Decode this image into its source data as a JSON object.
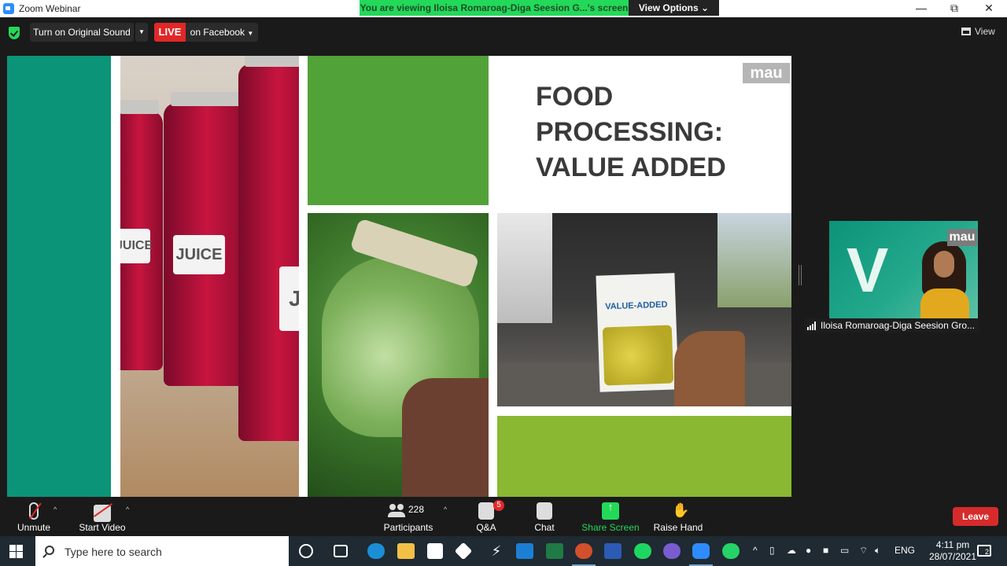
{
  "window": {
    "app_title": "Zoom Webinar",
    "viewing_banner": "You are viewing Iloisa Romaroag-Diga Seesion G...'s screen",
    "view_options": "View Options",
    "controls": {
      "minimize": "—",
      "restore": "⧉",
      "close": "✕"
    }
  },
  "topbar": {
    "original_sound": "Turn on Original Sound",
    "live": "LIVE",
    "live_on": "on Facebook",
    "view": "View"
  },
  "slide": {
    "title_lines": [
      "FOOD",
      "PROCESSING:",
      "VALUE ADDED"
    ],
    "logo": "mau",
    "jar_labels": [
      "JUICE",
      "JUICE",
      "JU"
    ],
    "booklet_title": "VALUE-ADDED"
  },
  "video": {
    "logo": "mau",
    "name": "Iloisa Romaroag-Diga Seesion Gro..."
  },
  "toolbar": {
    "unmute": "Unmute",
    "start_video": "Start Video",
    "participants_count": "228",
    "participants": "Participants",
    "qa": "Q&A",
    "qa_badge": "5",
    "chat": "Chat",
    "share_screen": "Share Screen",
    "raise_hand": "Raise Hand",
    "leave": "Leave"
  },
  "taskbar": {
    "search_placeholder": "Type here to search",
    "language": "ENG",
    "time": "4:11 pm",
    "date": "28/07/2021",
    "notifications": "2"
  },
  "colors": {
    "teal": "#0c9478",
    "green": "#52a23a",
    "lime": "#8ab833",
    "zoom_green": "#23d959",
    "live_red": "#e02828",
    "leave_red": "#d72b2b"
  }
}
